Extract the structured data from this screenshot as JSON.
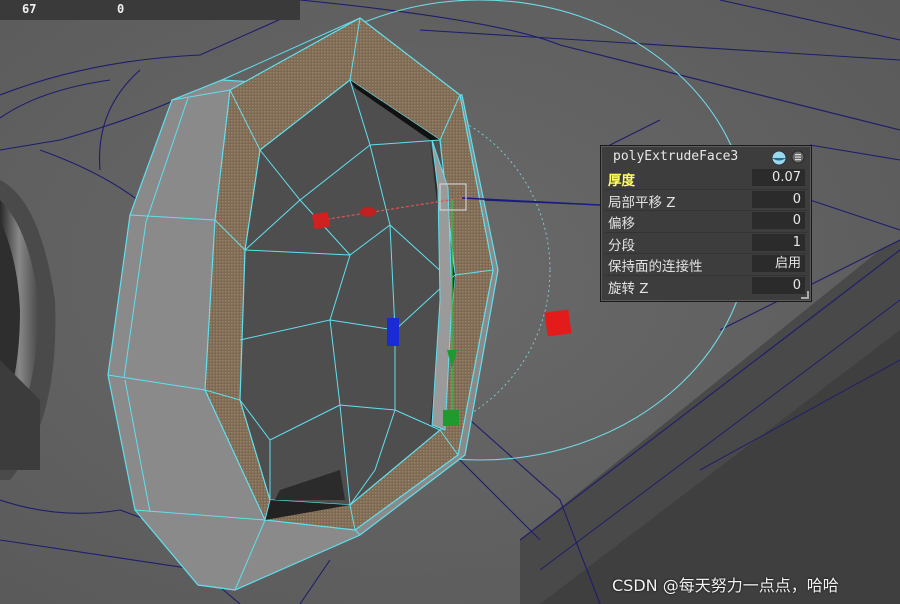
{
  "hud": {
    "value_left": "67",
    "value_right": "0"
  },
  "channel_box": {
    "node_name": "polyExtrudeFace3",
    "attributes": [
      {
        "label": "厚度",
        "value": "0.07",
        "highlighted": true
      },
      {
        "label": "局部平移 Z",
        "value": "0",
        "highlighted": false
      },
      {
        "label": "偏移",
        "value": "0",
        "highlighted": false
      },
      {
        "label": "分段",
        "value": "1",
        "highlighted": false
      },
      {
        "label": "保持面的连接性",
        "value": "启用",
        "highlighted": false
      },
      {
        "label": "旋转 Z",
        "value": "0",
        "highlighted": false
      }
    ]
  },
  "watermark": "CSDN @每天努力一点点，哈哈",
  "colors": {
    "background": "#606060",
    "wire_selected": "#5fe0ef",
    "wire_unselected": "#1d1d6e",
    "extrude_face": "#7b6b58",
    "manip_red": "#e02020",
    "manip_green": "#1f9a2f",
    "manip_blue": "#1a2bd6"
  }
}
